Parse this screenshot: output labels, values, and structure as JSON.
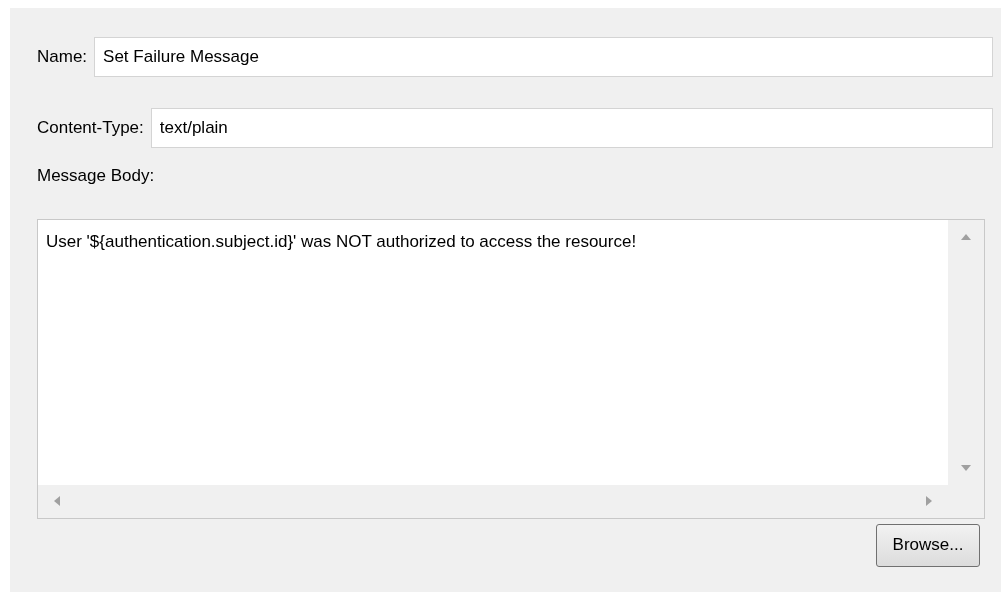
{
  "fields": [
    {
      "label": "Name:",
      "value": "Set Failure Message"
    },
    {
      "label": "Content-Type:",
      "value": "text/plain"
    }
  ],
  "message_body": {
    "label": "Message Body:",
    "value": "User '${authentication.subject.id}' was NOT authorized to access the resource!"
  },
  "buttons": [
    "Browse..."
  ]
}
